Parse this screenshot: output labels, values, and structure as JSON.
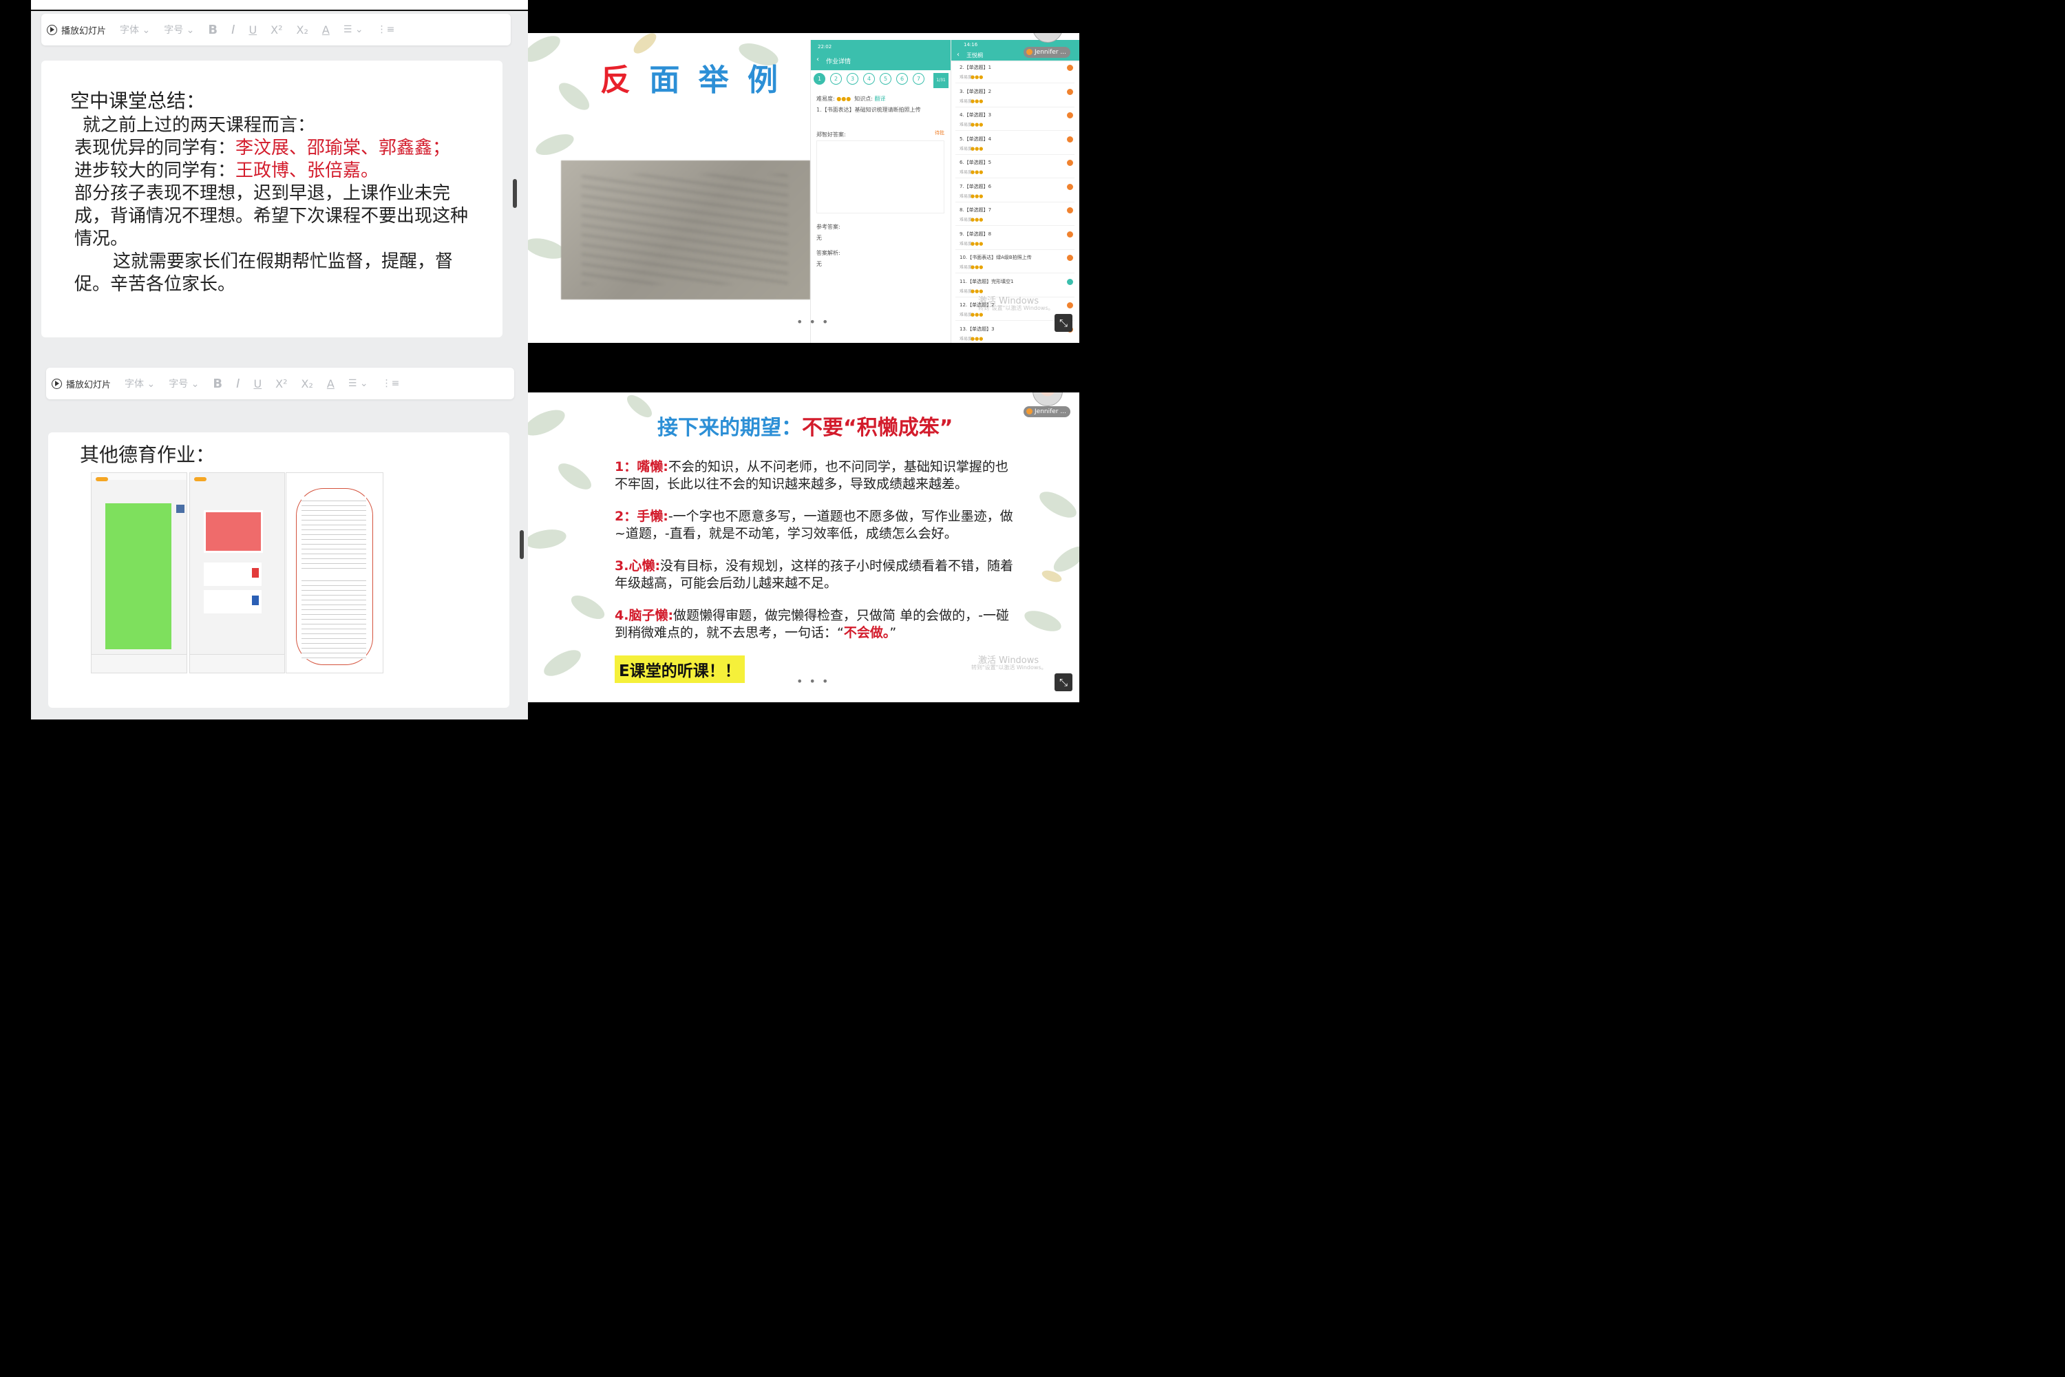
{
  "toolbar": {
    "play_label": "播放幻灯片",
    "font_label": "字体",
    "size_label": "字号",
    "bold": "B",
    "italic": "I",
    "underline": "U",
    "superscript": "X²",
    "subscript": "X₂",
    "font_color": "A",
    "list": "☰",
    "numbered_list": "⋮≡"
  },
  "summary_slide": {
    "title": "空中课堂总结：",
    "line1": "就之前上过的两天课程而言：",
    "excellent_prefix": "表现优异的同学有：",
    "excellent_names": "李汶展、邵瑜棠、郭鑫鑫；",
    "progress_prefix": "进步较大的同学有：",
    "progress_names": "王政博、张倍嘉。",
    "paragraph1": "部分孩子表现不理想，迟到早退，上课作业未完成，背诵情况不理想。希望下次课程不要出现这种情况。",
    "paragraph2": "这就需要家长们在假期帮忙监督，提醒，督促。辛苦各位家长。"
  },
  "moral_slide": {
    "title": "其他德育作业："
  },
  "negative_example_slide": {
    "title": "反 面 举 例",
    "title_colors": [
      "#e8212b",
      "#2c8fd6",
      "#2c8fd6",
      "#2c8fd6"
    ],
    "phone1": {
      "time": "22:02",
      "header": "作业详情",
      "numbers": [
        "1",
        "2",
        "3",
        "4",
        "5",
        "6",
        "7"
      ],
      "difficulty_label": "难易度:",
      "knowledge_label": "知识点:",
      "knowledge_value": "翻译",
      "question": "1.【书面表达】基础知识梳理请断拍照上传",
      "answer_label": "郑智好答案:",
      "answer_status": "待批",
      "reference_label": "参考答案:",
      "reference_value": "无",
      "analysis_label": "答案解析:",
      "analysis_value": "无",
      "page_indicator": "1/31"
    },
    "phone2": {
      "time": "14:16",
      "header": "王悦桐",
      "difficulty_short": "难易度:",
      "questions": [
        "2.【单选题】1",
        "3.【单选题】2",
        "4.【单选题】3",
        "5.【单选题】4",
        "6.【单选题】5",
        "7.【单选题】6",
        "8.【单选题】7",
        "9.【单选题】8",
        "10.【书面表达】绿A级B拍照上传",
        "11.【单选题】完形填空1",
        "12.【单选题】2",
        "13.【单选题】3"
      ]
    },
    "user_name": "Jennifer ...",
    "watermark": "激活 Windows",
    "watermark_sub": "转到\"设置\"以激活 Windows。"
  },
  "expectation_slide": {
    "title_blue": "接下来的期望：",
    "title_red": "不要“积懒成笨”",
    "items": [
      {
        "key": "1：嘴懒:",
        "text": "不会的知识，从不问老师，也不问同学，基础知识掌握的也不牢固，长此以往不会的知识越来越多，导致成绩越来越差。"
      },
      {
        "key": "2：手懒:",
        "text": "-一个字也不愿意多写，一道题也不愿多做，写作业墨迹，做~道题，-直看，就是不动笔，学习效率低，成绩怎么会好。"
      },
      {
        "key": "3.心懒:",
        "text": "没有目标，没有规划，这样的孩子小时候成绩看着不错，随着年级越高，可能会后劲儿越来越不足。"
      },
      {
        "key": "4.脑子懒:",
        "text": "做题懒得审题，做完懒得检查，只做简 单的会做的，-一碰到稍微难点的，就不去思考，一句话：“"
      },
      {
        "key": "",
        "text": "不会做。"
      }
    ],
    "item4_end": "”",
    "highlight": "E课堂的听课！！",
    "user_name": "Jennifer ...",
    "watermark": "激活 Windows",
    "watermark_sub": "转到\"设置\"以激活 Windows。"
  },
  "dots": "• • •",
  "expand_icon": "⤡"
}
